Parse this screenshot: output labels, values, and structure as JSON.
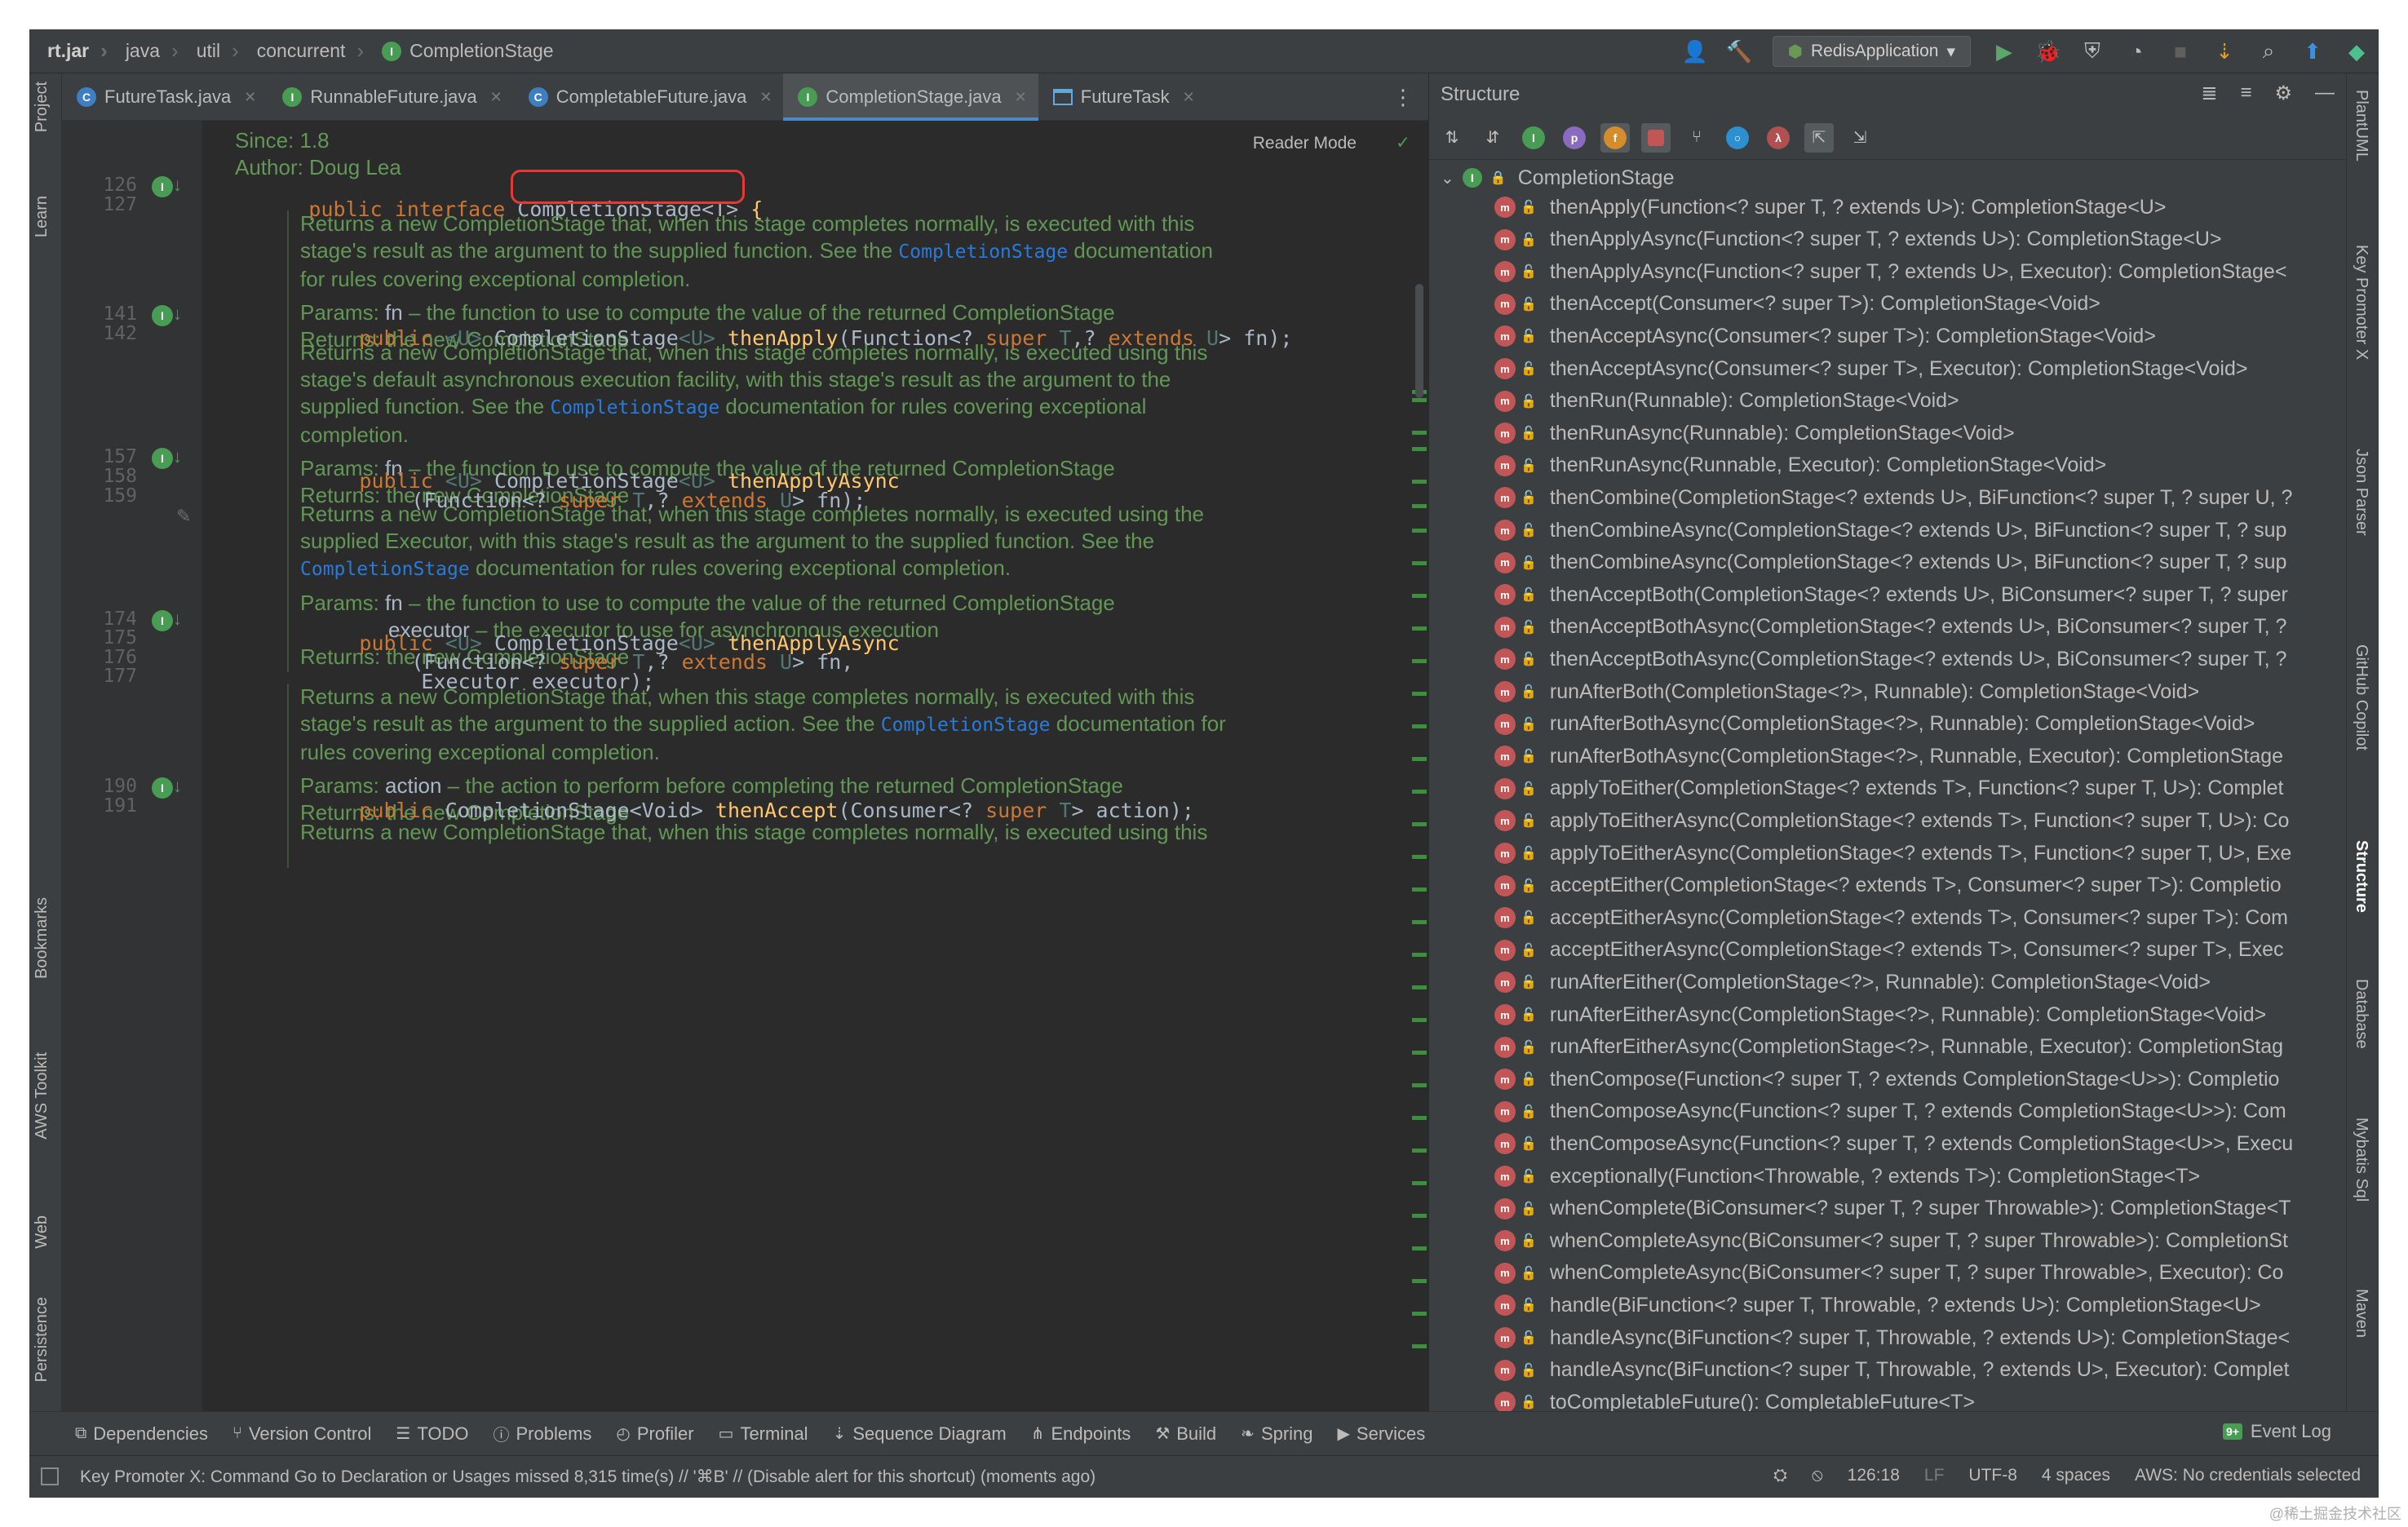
{
  "breadcrumb": {
    "items": [
      "rt.jar",
      "java",
      "util",
      "concurrent",
      "CompletionStage"
    ]
  },
  "navbar": {
    "run_config": "RedisApplication"
  },
  "left_strip": [
    "Project",
    "Learn",
    "Bookmarks",
    "AWS Toolkit",
    "Web",
    "Persistence"
  ],
  "right_strip": [
    "PlantUML",
    "Key Promoter X",
    "Json Parser",
    "GitHub Copilot",
    "Structure",
    "Database",
    "Mybatis Sql",
    "Maven"
  ],
  "editor": {
    "tabs": [
      {
        "label": "FutureTask.java",
        "icon": "class"
      },
      {
        "label": "RunnableFuture.java",
        "icon": "interface"
      },
      {
        "label": "CompletableFuture.java",
        "icon": "class"
      },
      {
        "label": "CompletionStage.java",
        "icon": "interface",
        "active": true
      },
      {
        "label": "FutureTask",
        "icon": "tree"
      }
    ],
    "reader_mode": "Reader Mode",
    "header_doc": {
      "since": "Since:  1.8",
      "author": "Author: Doug Lea"
    },
    "lines": {
      "l126": "126",
      "l127": "127",
      "l141": "141",
      "l142": "142",
      "l157": "157",
      "l158": "158",
      "l159": "159",
      "l174": "174",
      "l175": "175",
      "l176": "176",
      "l177": "177",
      "l190": "190",
      "l191": "191"
    },
    "code": {
      "decl_kw": "public interface ",
      "decl_name": "CompletionStage<T>",
      "decl_brace": " {",
      "thenApply": {
        "kw": "public ",
        "tp1": "<U> ",
        "ret": "CompletionStage",
        "ret_tp": "<U> ",
        "name": "thenApply",
        "args_a": "(Function<? ",
        "sup": "super ",
        "t": "T",
        "args_b": ",? ",
        "ext": "extends ",
        "u": "U",
        "args_c": "> fn);"
      },
      "thenApplyAsync1": {
        "kw": "public ",
        "tp1": "<U> ",
        "ret": "CompletionStage",
        "ret_tp": "<U> ",
        "name": "thenApplyAsync",
        "l2a": "(Function<? ",
        "sup": "super ",
        "t": "T",
        "l2b": ",? ",
        "ext": "extends ",
        "u": "U",
        "l2c": "> fn);"
      },
      "thenApplyAsync2": {
        "kw": "public ",
        "tp1": "<U> ",
        "ret": "CompletionStage",
        "ret_tp": "<U> ",
        "name": "thenApplyAsync",
        "l2a": "(Function<? ",
        "sup": "super ",
        "t": "T",
        "l2b": ",? ",
        "ext": "extends ",
        "u": "U",
        "l2c": "> fn,",
        "l3": "Executor executor);"
      },
      "thenAccept": {
        "kw": "public ",
        "ret": "CompletionStage",
        "ret_tp": "<Void> ",
        "name": "thenAccept",
        "a": "(Consumer<? ",
        "sup": "super ",
        "t": "T",
        "b": "> action);"
      }
    },
    "docs": {
      "d1": {
        "a": "Returns a new CompletionStage that, when this stage completes normally, is executed with this",
        "b1": "stage's result as the argument to the supplied function. See the ",
        "link": "CompletionStage",
        "b2": " documentation",
        "c": "for rules covering exceptional completion.",
        "params_label": "Params:",
        "param": "fn",
        "param_desc": " – the function to use to compute the value of the returned CompletionStage",
        "returns": "Returns: the new CompletionStage"
      },
      "d2": {
        "a": "Returns a new CompletionStage that, when this stage completes normally, is executed using this",
        "b": "stage's default asynchronous execution facility, with this stage's result as the argument to the",
        "c1": "supplied function. See the ",
        "link": "CompletionStage",
        "c2": " documentation for rules covering exceptional",
        "d": "completion.",
        "params_label": "Params:",
        "param": "fn",
        "param_desc": " – the function to use to compute the value of the returned CompletionStage",
        "returns": "Returns: the new CompletionStage"
      },
      "d3": {
        "a": "Returns a new CompletionStage that, when this stage completes normally, is executed using the",
        "b": "supplied Executor, with this stage's result as the argument to the supplied function. See the",
        "link": "CompletionStage",
        "c": " documentation for rules covering exceptional completion.",
        "params_label": "Params:",
        "param": "fn",
        "param_desc": " – the function to use to compute the value of the returned CompletionStage",
        "param2": "executor",
        "param2_desc": " – the executor to use for asynchronous execution",
        "returns": "Returns: the new CompletionStage"
      },
      "d4": {
        "a": "Returns a new CompletionStage that, when this stage completes normally, is executed with this",
        "b1": "stage's result as the argument to the supplied action. See the ",
        "link": "CompletionStage",
        "b2": " documentation for",
        "c": "rules covering exceptional completion.",
        "params_label": "Params:",
        "param": "action",
        "param_desc": " – the action to perform before completing the returned CompletionStage",
        "returns": "Returns: the new CompletionStage"
      },
      "d5": {
        "a": "Returns a new CompletionStage that, when this stage completes normally, is executed using this"
      }
    }
  },
  "structure": {
    "title": "Structure",
    "root": "CompletionStage",
    "items": [
      "thenApply(Function<? super T, ? extends U>): CompletionStage<U>",
      "thenApplyAsync(Function<? super T, ? extends U>): CompletionStage<U>",
      "thenApplyAsync(Function<? super T, ? extends U>, Executor): CompletionStage<",
      "thenAccept(Consumer<? super T>): CompletionStage<Void>",
      "thenAcceptAsync(Consumer<? super T>): CompletionStage<Void>",
      "thenAcceptAsync(Consumer<? super T>, Executor): CompletionStage<Void>",
      "thenRun(Runnable): CompletionStage<Void>",
      "thenRunAsync(Runnable): CompletionStage<Void>",
      "thenRunAsync(Runnable, Executor): CompletionStage<Void>",
      "thenCombine(CompletionStage<? extends U>, BiFunction<? super T, ? super U, ?",
      "thenCombineAsync(CompletionStage<? extends U>, BiFunction<? super T, ? sup",
      "thenCombineAsync(CompletionStage<? extends U>, BiFunction<? super T, ? sup",
      "thenAcceptBoth(CompletionStage<? extends U>, BiConsumer<? super T, ? super",
      "thenAcceptBothAsync(CompletionStage<? extends U>, BiConsumer<? super T, ?",
      "thenAcceptBothAsync(CompletionStage<? extends U>, BiConsumer<? super T, ?",
      "runAfterBoth(CompletionStage<?>, Runnable): CompletionStage<Void>",
      "runAfterBothAsync(CompletionStage<?>, Runnable): CompletionStage<Void>",
      "runAfterBothAsync(CompletionStage<?>, Runnable, Executor): CompletionStage",
      "applyToEither(CompletionStage<? extends T>, Function<? super T, U>): Complet",
      "applyToEitherAsync(CompletionStage<? extends T>, Function<? super T, U>): Co",
      "applyToEitherAsync(CompletionStage<? extends T>, Function<? super T, U>, Exe",
      "acceptEither(CompletionStage<? extends T>, Consumer<? super T>): Completio",
      "acceptEitherAsync(CompletionStage<? extends T>, Consumer<? super T>): Com",
      "acceptEitherAsync(CompletionStage<? extends T>, Consumer<? super T>, Exec",
      "runAfterEither(CompletionStage<?>, Runnable): CompletionStage<Void>",
      "runAfterEitherAsync(CompletionStage<?>, Runnable): CompletionStage<Void>",
      "runAfterEitherAsync(CompletionStage<?>, Runnable, Executor): CompletionStag",
      "thenCompose(Function<? super T, ? extends CompletionStage<U>>): Completio",
      "thenComposeAsync(Function<? super T, ? extends CompletionStage<U>>): Com",
      "thenComposeAsync(Function<? super T, ? extends CompletionStage<U>>, Execu",
      "exceptionally(Function<Throwable, ? extends T>): CompletionStage<T>",
      "whenComplete(BiConsumer<? super T, ? super Throwable>): CompletionStage<T",
      "whenCompleteAsync(BiConsumer<? super T, ? super Throwable>): CompletionSt",
      "whenCompleteAsync(BiConsumer<? super T, ? super Throwable>, Executor): Co",
      "handle(BiFunction<? super T, Throwable, ? extends U>): CompletionStage<U>",
      "handleAsync(BiFunction<? super T, Throwable, ? extends U>): CompletionStage<",
      "handleAsync(BiFunction<? super T, Throwable, ? extends U>, Executor): Complet",
      "toCompletableFuture(): CompletableFuture<T>"
    ]
  },
  "bottom_tools": [
    {
      "label": "Dependencies",
      "icon": "layers-icon"
    },
    {
      "label": "Version Control",
      "icon": "branch-icon"
    },
    {
      "label": "TODO",
      "icon": "list-icon"
    },
    {
      "label": "Problems",
      "icon": "info-icon"
    },
    {
      "label": "Profiler",
      "icon": "gauge-icon"
    },
    {
      "label": "Terminal",
      "icon": "terminal-icon"
    },
    {
      "label": "Sequence Diagram",
      "icon": "sequence-icon"
    },
    {
      "label": "Endpoints",
      "icon": "endpoints-icon"
    },
    {
      "label": "Build",
      "icon": "hammer-icon"
    },
    {
      "label": "Spring",
      "icon": "leaf-icon"
    },
    {
      "label": "Services",
      "icon": "play-circle-icon"
    }
  ],
  "event_log": {
    "badge": "9+",
    "label": "Event Log"
  },
  "status": {
    "message": "Key Promoter X: Command Go to Declaration or Usages missed 8,315 time(s) // '⌘B' // (Disable alert for this shortcut) (moments ago)",
    "position": "126:18",
    "line_sep": "LF",
    "encoding": "UTF-8",
    "indent": "4 spaces",
    "aws": "AWS: No credentials selected"
  },
  "watermark": "@稀土掘金技术社区",
  "colors": {
    "accent_tab": "#4a88c7",
    "interface_green": "#499c54",
    "method_red": "#c25656",
    "highlight": "#e53935"
  }
}
